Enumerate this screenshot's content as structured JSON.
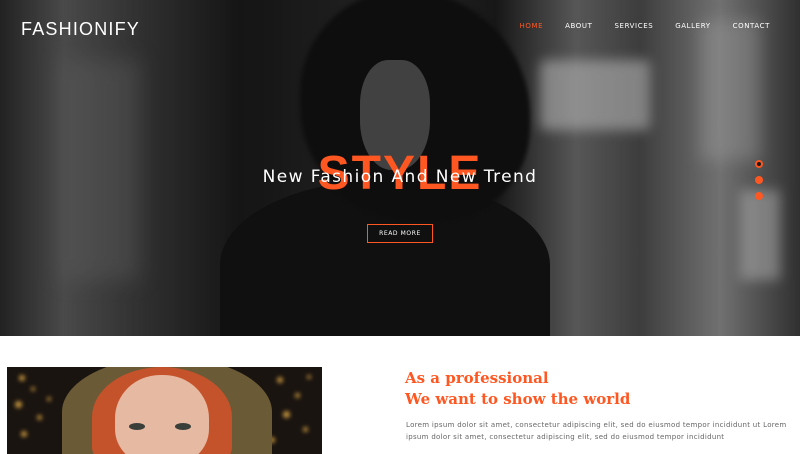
{
  "brand": {
    "logo_text": "FASHIONIFY",
    "accent_color": "#ff5722"
  },
  "nav": {
    "items": [
      {
        "label": "HOME",
        "active": true
      },
      {
        "label": "ABOUT",
        "active": false
      },
      {
        "label": "SERVICES",
        "active": false
      },
      {
        "label": "GALLERY",
        "active": false
      },
      {
        "label": "CONTACT",
        "active": false
      }
    ]
  },
  "hero": {
    "big_word": "STYLE",
    "tagline": "New Fashion And New Trend",
    "button_label": "READ MORE",
    "slider_dots": 3,
    "active_dot": 0
  },
  "about": {
    "title_line1": "As a professional",
    "title_line2": "We want to show the world",
    "body": "Lorem ipsum dolor sit amet, consectetur adipiscing elit, sed do eiusmod tempor incididunt ut Lorem ipsum dolor sit amet, consectetur adipiscing elit, sed do eiusmod tempor incididunt"
  }
}
